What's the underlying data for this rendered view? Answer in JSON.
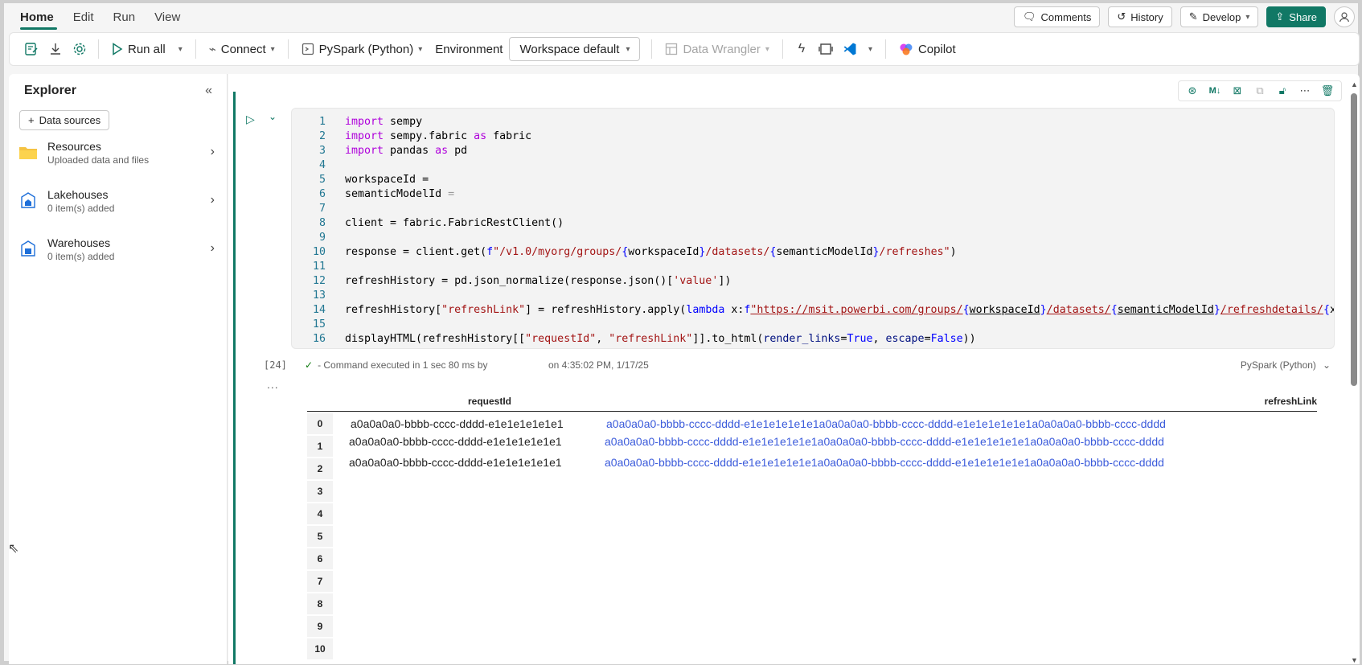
{
  "menu": {
    "tabs": [
      "Home",
      "Edit",
      "Run",
      "View"
    ],
    "comments": "Comments",
    "history": "History",
    "develop": "Develop",
    "share": "Share"
  },
  "toolbar": {
    "run_all": "Run all",
    "connect": "Connect",
    "language": "PySpark (Python)",
    "environment": "Environment",
    "workspace": "Workspace default",
    "data_wrangler": "Data Wrangler",
    "copilot": "Copilot"
  },
  "explorer": {
    "title": "Explorer",
    "data_sources": "Data sources",
    "items": [
      {
        "title": "Resources",
        "subtitle": "Uploaded data and files"
      },
      {
        "title": "Lakehouses",
        "subtitle": "0 item(s) added"
      },
      {
        "title": "Warehouses",
        "subtitle": "0 item(s) added"
      }
    ]
  },
  "cell": {
    "execution_count": "[24]",
    "status": "- Command executed in 1 sec 80 ms by",
    "time": "on 4:35:02 PM, 1/17/25",
    "language": "PySpark (Python)",
    "ellipsis": "...",
    "tools": [
      "copilot",
      "M↓",
      "clear",
      "copy",
      "lock",
      "more",
      "delete"
    ]
  },
  "output": {
    "columns": [
      "requestId",
      "refreshLink"
    ],
    "indices": [
      "0",
      "1",
      "2",
      "3",
      "4",
      "5",
      "6",
      "7",
      "8",
      "9",
      "10"
    ],
    "rows": [
      {
        "requestId": "a0a0a0a0-bbbb-cccc-dddd-e1e1e1e1e1e1",
        "refreshLink": "a0a0a0a0-bbbb-cccc-dddd-e1e1e1e1e1e1a0a0a0a0-bbbb-cccc-dddd-e1e1e1e1e1e1a0a0a0a0-bbbb-cccc-dddd"
      },
      {
        "requestId": "a0a0a0a0-bbbb-cccc-dddd-e1e1e1e1e1e1",
        "refreshLink": "a0a0a0a0-bbbb-cccc-dddd-e1e1e1e1e1e1a0a0a0a0-bbbb-cccc-dddd-e1e1e1e1e1e1a0a0a0a0-bbbb-cccc-dddd"
      },
      {
        "requestId": "a0a0a0a0-bbbb-cccc-dddd-e1e1e1e1e1e1",
        "refreshLink": "a0a0a0a0-bbbb-cccc-dddd-e1e1e1e1e1e1a0a0a0a0-bbbb-cccc-dddd-e1e1e1e1e1e1a0a0a0a0-bbbb-cccc-dddd"
      }
    ]
  },
  "colors": {
    "accent": "#117865",
    "link": "#3b5bdb",
    "keyword": "#af00db",
    "string": "#a31515"
  }
}
